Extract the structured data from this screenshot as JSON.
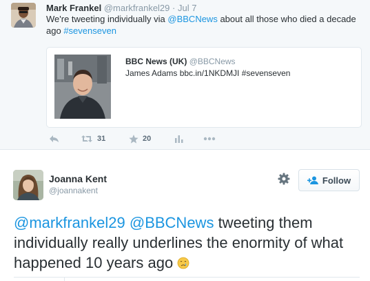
{
  "quoting_tweet": {
    "author_name": "Mark Frankel",
    "author_handle": "@markfrankel29",
    "separator": "·",
    "date": "Jul 7",
    "text_before": "We're tweeting individually via ",
    "mention": "@BBCNews",
    "text_after": " about all those who died a decade ago ",
    "hashtag": "#sevenseven",
    "quoted": {
      "author_name": "BBC News (UK)",
      "author_handle": "@BBCNews",
      "text": "James Adams bbc.in/1NKDMJI #sevenseven"
    },
    "actions": {
      "retweet_count": "31",
      "favorite_count": "20"
    }
  },
  "main_tweet": {
    "author_name": "Joanna Kent",
    "author_handle": "@joannakent",
    "follow_label": "Follow",
    "mention_1": "@markfrankel29",
    "mention_2": "@BBCNews",
    "text": " tweeting them individually really underlines the enormity of what happened 10 years ago"
  },
  "icons": {
    "reply": "reply-icon",
    "retweet": "retweet-icon",
    "favorite": "star-icon",
    "analytics": "analytics-icon",
    "more": "more-icon",
    "settings": "gear-icon",
    "follow": "add-user-icon",
    "emoji": "crying-face-emoji"
  },
  "colors": {
    "link": "#1b95e0",
    "muted": "#8899a6",
    "text": "#292f33",
    "background_top": "#f5f8fa"
  }
}
